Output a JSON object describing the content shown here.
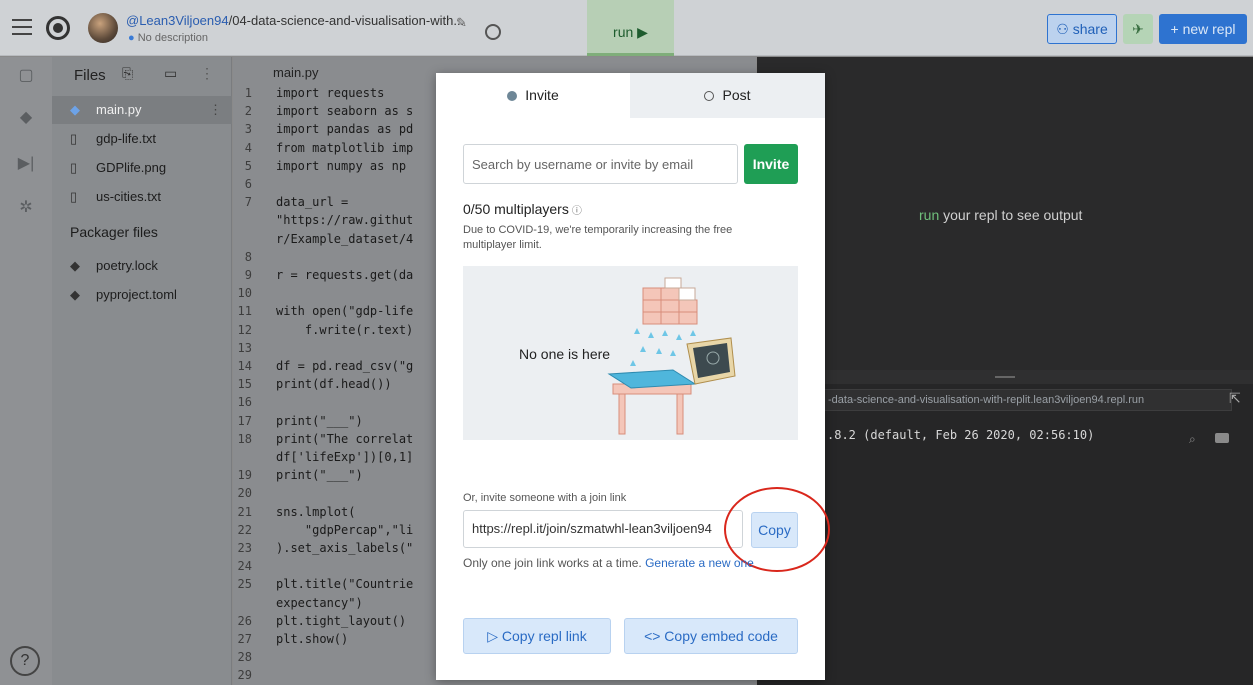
{
  "topbar": {
    "username": "@Lean3Viljoen94",
    "repl_path": "/04-data-science-and-visualisation-with...",
    "description": "No description",
    "run_label": "run ▶",
    "share_label": "share",
    "new_repl_label": "+ new repl"
  },
  "files": {
    "header": "Files",
    "items": [
      {
        "name": "main.py",
        "icon": "python-icon"
      },
      {
        "name": "gdp-life.txt",
        "icon": "file-icon"
      },
      {
        "name": "GDPlife.png",
        "icon": "file-icon"
      },
      {
        "name": "us-cities.txt",
        "icon": "file-icon"
      }
    ],
    "packager_header": "Packager files",
    "packager_items": [
      {
        "name": "poetry.lock",
        "icon": "package-icon"
      },
      {
        "name": "pyproject.toml",
        "icon": "package-icon"
      }
    ]
  },
  "editor": {
    "tab": "main.py",
    "lines": [
      {
        "n": "1",
        "t": "import requests"
      },
      {
        "n": "2",
        "t": "import seaborn as s"
      },
      {
        "n": "3",
        "t": "import pandas as pd"
      },
      {
        "n": "4",
        "t": "from matplotlib imp"
      },
      {
        "n": "5",
        "t": "import numpy as np"
      },
      {
        "n": "6",
        "t": ""
      },
      {
        "n": "7",
        "t": "data_url ="
      },
      {
        "n": "",
        "t": "\"https://raw.githut"
      },
      {
        "n": "",
        "t": "r/Example_dataset/4"
      },
      {
        "n": "8",
        "t": ""
      },
      {
        "n": "9",
        "t": "r = requests.get(da"
      },
      {
        "n": "10",
        "t": ""
      },
      {
        "n": "11",
        "t": "with open(\"gdp-life"
      },
      {
        "n": "12",
        "t": "    f.write(r.text)"
      },
      {
        "n": "13",
        "t": ""
      },
      {
        "n": "14",
        "t": "df = pd.read_csv(\"g"
      },
      {
        "n": "15",
        "t": "print(df.head())"
      },
      {
        "n": "16",
        "t": ""
      },
      {
        "n": "17",
        "t": "print(\"___\")"
      },
      {
        "n": "18",
        "t": "print(\"The correlat"
      },
      {
        "n": "",
        "t": "df['lifeExp'])[0,1]"
      },
      {
        "n": "19",
        "t": "print(\"___\")"
      },
      {
        "n": "20",
        "t": ""
      },
      {
        "n": "21",
        "t": "sns.lmplot("
      },
      {
        "n": "22",
        "t": "    \"gdpPercap\",\"li"
      },
      {
        "n": "23",
        "t": ").set_axis_labels(\""
      },
      {
        "n": "24",
        "t": ""
      },
      {
        "n": "25",
        "t": "plt.title(\"Countrie"
      },
      {
        "n": "",
        "t": "expectancy\")"
      },
      {
        "n": "26",
        "t": "plt.tight_layout()"
      },
      {
        "n": "27",
        "t": "plt.show()"
      },
      {
        "n": "28",
        "t": ""
      },
      {
        "n": "29",
        "t": ""
      }
    ]
  },
  "output": {
    "run_word": "run",
    "hint_rest": " your repl to see output"
  },
  "console": {
    "url": "-data-science-and-visualisation-with-replit.lean3viljoen94.repl.run",
    "python_version": ".8.2 (default, Feb 26 2020, 02:56:10)"
  },
  "modal": {
    "tab_invite": "Invite",
    "tab_post": "Post",
    "search_placeholder": "Search by username or invite by email",
    "invite_button": "Invite",
    "multiplayers": "0/50 multiplayers",
    "covid_note": "Due to COVID-19, we're temporarily increasing the free multiplayer limit.",
    "empty_text": "No one is here",
    "join_label": "Or, invite someone with a join link",
    "join_url": "https://repl.it/join/szmatwhl-lean3viljoen94",
    "copy_button": "Copy",
    "join_note": "Only one join link works at a time.",
    "generate_link": "Generate a new one",
    "copy_repl_link": "▷ Copy repl link",
    "copy_embed_code": "<> Copy embed code"
  }
}
